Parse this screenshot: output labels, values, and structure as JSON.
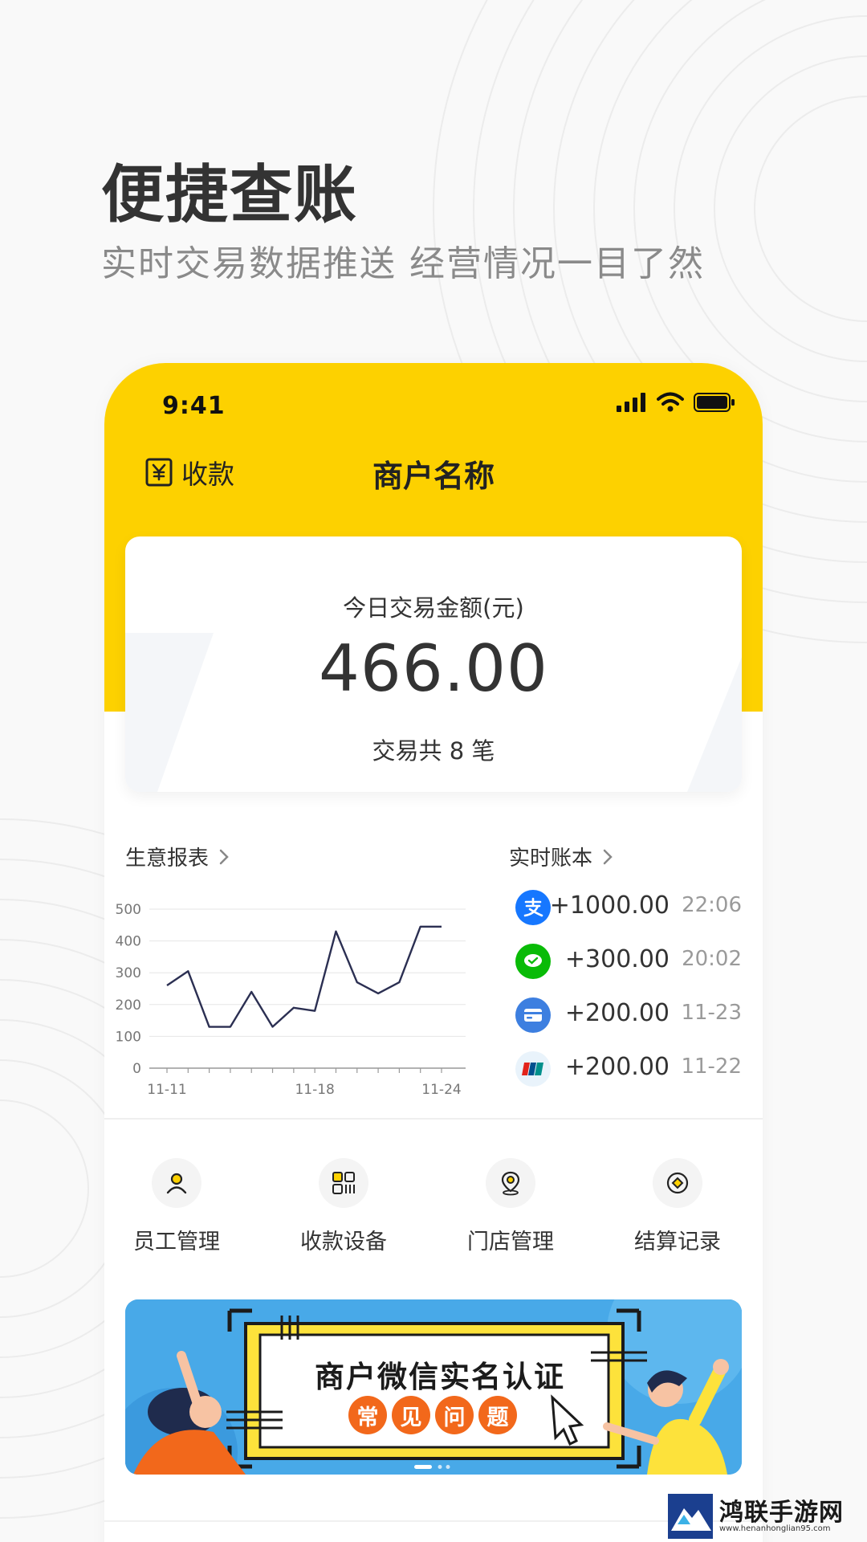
{
  "hero": {
    "headline": "便捷查账",
    "subline": "实时交易数据推送  经营情况一目了然"
  },
  "status_bar": {
    "time": "9:41"
  },
  "nav": {
    "receive_label": "收款",
    "title": "商户名称"
  },
  "summary_card": {
    "label": "今日交易金额(元)",
    "amount": "466.00",
    "count_text": "交易共 8 笔"
  },
  "business_report": {
    "link_label": "生意报表",
    "chart_data": {
      "type": "line",
      "title": "",
      "xlabel": "",
      "ylabel": "",
      "ylim": [
        0,
        500
      ],
      "yticks": [
        "0",
        "100",
        "200",
        "300",
        "400",
        "500"
      ],
      "xticks": [
        "11-11",
        "11-18",
        "11-24"
      ],
      "x": [
        "11-11",
        "11-12",
        "11-13",
        "11-14",
        "11-15",
        "11-16",
        "11-17",
        "11-18",
        "11-19",
        "11-20",
        "11-21",
        "11-22",
        "11-23",
        "11-24"
      ],
      "series": [
        {
          "values": [
            260,
            305,
            130,
            130,
            240,
            130,
            190,
            180,
            430,
            270,
            235,
            270,
            445,
            445
          ]
        }
      ],
      "grid": true,
      "colors": {
        "line": "#2b2f52",
        "grid": "#e6e6e6"
      }
    }
  },
  "realtime_ledger": {
    "link_label": "实时账本",
    "entries": [
      {
        "icon": "alipay-icon",
        "icon_color": "#1677ff",
        "amount": "+1000.00",
        "time": "22:06"
      },
      {
        "icon": "wechat-pay-icon",
        "icon_color": "#09bb07",
        "amount": "+300.00",
        "time": "20:02"
      },
      {
        "icon": "bank-card-icon",
        "icon_color": "#3d7fe0",
        "amount": "+200.00",
        "time": "11-23"
      },
      {
        "icon": "unionpay-icon",
        "icon_color": "#e9f3fb",
        "amount": "+200.00",
        "time": "11-22"
      }
    ]
  },
  "menu": {
    "items": [
      {
        "label": "员工管理",
        "icon": "staff-icon"
      },
      {
        "label": "收款设备",
        "icon": "device-icon"
      },
      {
        "label": "门店管理",
        "icon": "store-location-icon"
      },
      {
        "label": "结算记录",
        "icon": "settlement-icon"
      }
    ]
  },
  "banner": {
    "title": "商户微信实名认证",
    "pills": [
      "常",
      "见",
      "问",
      "题"
    ]
  },
  "watermark": {
    "name": "鸿联手游网",
    "url": "www.henanhonglian95.com"
  },
  "colors": {
    "brand_yellow": "#fdd100",
    "text_primary": "#333333",
    "text_secondary": "#8a8a8a",
    "banner_blue": "#48a9e8",
    "banner_orange": "#f2681b"
  }
}
